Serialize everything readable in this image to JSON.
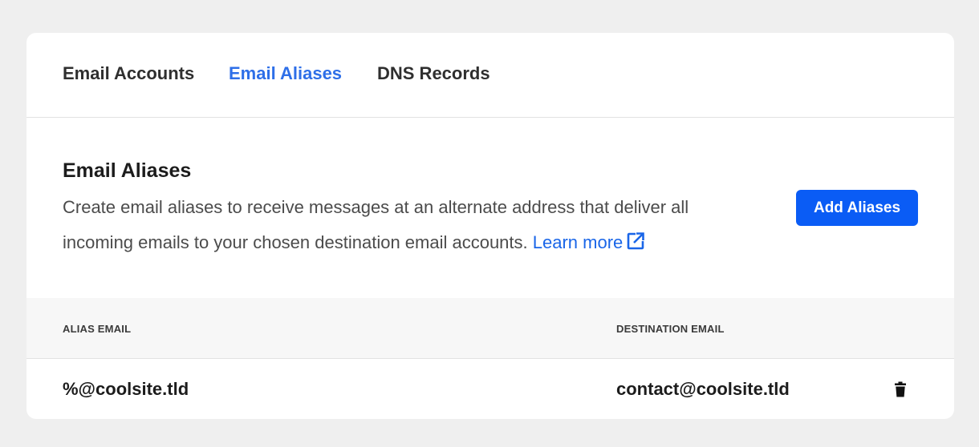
{
  "tabs": [
    {
      "label": "Email Accounts",
      "active": false
    },
    {
      "label": "Email Aliases",
      "active": true
    },
    {
      "label": "DNS Records",
      "active": false
    }
  ],
  "section": {
    "title": "Email Aliases",
    "description": "Create email aliases to receive messages at an alternate address that deliver all incoming emails to your chosen destination email accounts.",
    "learn_more_label": "Learn more",
    "learn_more_icon": "external-link-icon",
    "add_button_label": "Add Aliases"
  },
  "table": {
    "columns": [
      "ALIAS EMAIL",
      "DESTINATION EMAIL"
    ],
    "rows": [
      {
        "alias": "%@coolsite.tld",
        "destination": "contact@coolsite.tld",
        "action_icon": "trash-icon"
      }
    ]
  },
  "colors": {
    "accent": "#2e6fe8",
    "button": "#0a5cf5",
    "link": "#1a66e8"
  }
}
